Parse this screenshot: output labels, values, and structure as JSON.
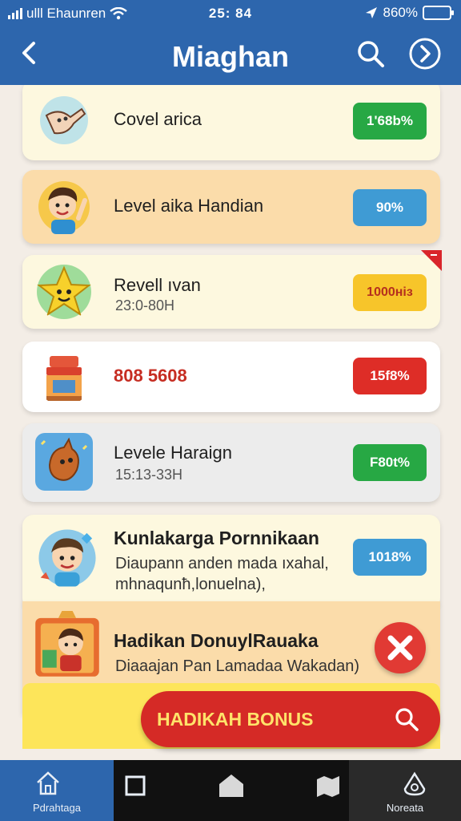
{
  "status_bar": {
    "carrier": "ulll Ehaunren",
    "time": "25: 84",
    "battery": "860%"
  },
  "app_bar": {
    "title": "Miaghan"
  },
  "list_items": [
    {
      "title": "Covel arica",
      "subtitle": "",
      "badge": "1'68b%",
      "badge_color": "#27a844",
      "icon": "cartoon-character-icon"
    },
    {
      "title": "Level aika Handian",
      "subtitle": "",
      "badge": "90%",
      "badge_color": "#3f9bd4",
      "icon": "boy-avatar-icon"
    },
    {
      "title": "Revell ıvan",
      "subtitle": "23:0-80H",
      "badge": "1000ніз",
      "badge_color": "#f7c52a",
      "icon": "star-character-icon"
    },
    {
      "title": "808 5608",
      "subtitle": "",
      "badge": "15f8%",
      "badge_color": "#de2d27",
      "icon": "shop-stall-icon"
    },
    {
      "title": "Levele Haraign",
      "subtitle": "15:13-33H",
      "badge": "F80t%",
      "badge_color": "#27a844",
      "icon": "critter-icon"
    },
    {
      "title": "Kunlakarga Pornnikaan",
      "subtitle": "Diaupann anden mada ıxahal,",
      "subtitle2": "mhnaqunħ,lonuelna),",
      "badge": "1018%",
      "badge_color": "#3f9bd4",
      "icon": "kid-avatar-icon"
    },
    {
      "title": "Hadikan DonuylRauaka",
      "subtitle": "Diaaajan Pan Lamadaa Wakadan)",
      "badge": "",
      "icon": "shop-kid-icon"
    }
  ],
  "bonus_button": {
    "label": "HADIKAH BONUS"
  },
  "bottom_nav": {
    "items": [
      {
        "label": "Pdrahtaga",
        "icon": "home-icon"
      },
      {
        "label": "",
        "icon": "square-icon"
      },
      {
        "label": "",
        "icon": "house-filled-icon"
      },
      {
        "label": "",
        "icon": "map-icon"
      },
      {
        "label": "Noreata",
        "icon": "drop-icon"
      }
    ]
  },
  "colors": {
    "header": "#2d66ad",
    "accent_red": "#d52a26",
    "nav_active": "#2d66ad"
  }
}
